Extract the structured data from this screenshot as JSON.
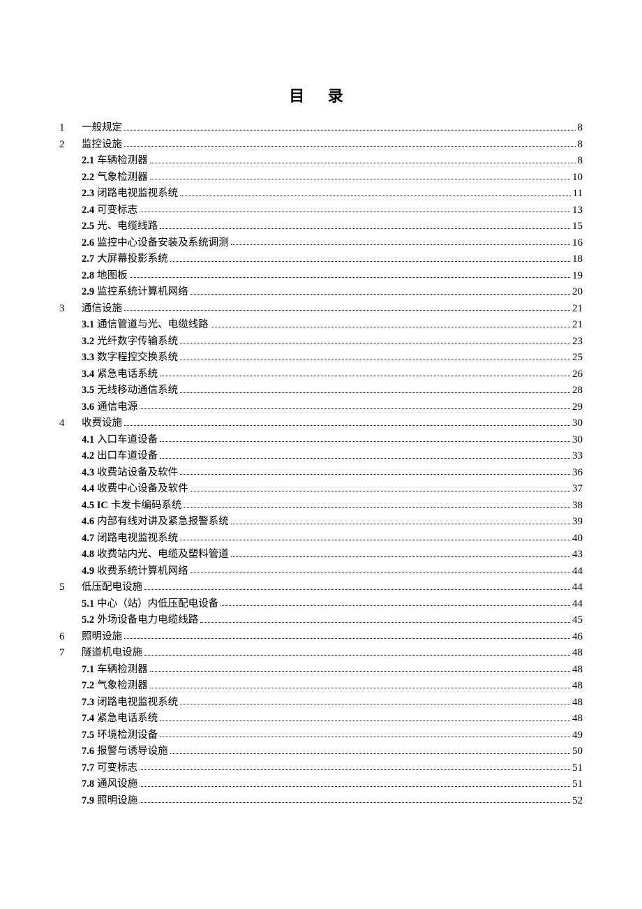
{
  "title": "目 录",
  "entries": [
    {
      "level": 1,
      "chapnum": "1",
      "secnum": "",
      "title": "一般规定",
      "page": "8"
    },
    {
      "level": 1,
      "chapnum": "2",
      "secnum": "",
      "title": "监控设施",
      "page": "8"
    },
    {
      "level": 2,
      "chapnum": "",
      "secnum": "2.1",
      "title": "车辆检测器",
      "page": "8"
    },
    {
      "level": 2,
      "chapnum": "",
      "secnum": "2.2",
      "title": "气象检测器",
      "page": "10"
    },
    {
      "level": 2,
      "chapnum": "",
      "secnum": "2.3",
      "title": "闭路电视监视系统",
      "page": "11"
    },
    {
      "level": 2,
      "chapnum": "",
      "secnum": "2.4",
      "title": "可变标志",
      "page": "13"
    },
    {
      "level": 2,
      "chapnum": "",
      "secnum": "2.5",
      "title": "光、电缆线路",
      "page": "15"
    },
    {
      "level": 2,
      "chapnum": "",
      "secnum": "2.6",
      "title": "监控中心设备安装及系统调测",
      "page": "16"
    },
    {
      "level": 2,
      "chapnum": "",
      "secnum": "2.7",
      "title": "大屏幕投影系统",
      "page": "18"
    },
    {
      "level": 2,
      "chapnum": "",
      "secnum": "2.8",
      "title": "地图板",
      "page": "19"
    },
    {
      "level": 2,
      "chapnum": "",
      "secnum": "2.9",
      "title": "监控系统计算机网络",
      "page": "20"
    },
    {
      "level": 1,
      "chapnum": "3",
      "secnum": "",
      "title": "通信设施",
      "page": "21"
    },
    {
      "level": 2,
      "chapnum": "",
      "secnum": "3.1",
      "title": "通信管道与光、电缆线路",
      "page": "21"
    },
    {
      "level": 2,
      "chapnum": "",
      "secnum": "3.2",
      "title": "光纤数字传输系统",
      "page": "23"
    },
    {
      "level": 2,
      "chapnum": "",
      "secnum": "3.3",
      "title": "数字程控交换系统",
      "page": "25"
    },
    {
      "level": 2,
      "chapnum": "",
      "secnum": "3.4",
      "title": "紧急电话系统",
      "page": "26"
    },
    {
      "level": 2,
      "chapnum": "",
      "secnum": "3.5",
      "title": "无线移动通信系统",
      "page": "28"
    },
    {
      "level": 2,
      "chapnum": "",
      "secnum": "3.6",
      "title": "通信电源",
      "page": "29"
    },
    {
      "level": 1,
      "chapnum": "4",
      "secnum": "",
      "title": "收费设施",
      "page": "30"
    },
    {
      "level": 2,
      "chapnum": "",
      "secnum": "4.1",
      "title": "入口车道设备",
      "page": "30"
    },
    {
      "level": 2,
      "chapnum": "",
      "secnum": "4.2",
      "title": "出口车道设备",
      "page": "33"
    },
    {
      "level": 2,
      "chapnum": "",
      "secnum": "4.3",
      "title": "收费站设备及软件",
      "page": "36"
    },
    {
      "level": 2,
      "chapnum": "",
      "secnum": "4.4",
      "title": "收费中心设备及软件",
      "page": "37"
    },
    {
      "level": 2,
      "chapnum": "",
      "secnum": "4.5 IC",
      "title": "卡发卡编码系统",
      "page": "38"
    },
    {
      "level": 2,
      "chapnum": "",
      "secnum": "4.6",
      "title": "内部有线对讲及紧急报警系统",
      "page": "39"
    },
    {
      "level": 2,
      "chapnum": "",
      "secnum": "4.7",
      "title": "闭路电视监视系统",
      "page": "40"
    },
    {
      "level": 2,
      "chapnum": "",
      "secnum": "4.8",
      "title": "收费站内光、电缆及塑料管道",
      "page": "43"
    },
    {
      "level": 2,
      "chapnum": "",
      "secnum": "4.9",
      "title": "收费系统计算机网络",
      "page": "44"
    },
    {
      "level": 1,
      "chapnum": "5",
      "secnum": "",
      "title": "低压配电设施",
      "page": "44"
    },
    {
      "level": 2,
      "chapnum": "",
      "secnum": "5.1",
      "title": "中心（站）内低压配电设备",
      "page": "44"
    },
    {
      "level": 2,
      "chapnum": "",
      "secnum": "5.2",
      "title": "外场设备电力电缆线路",
      "page": "45"
    },
    {
      "level": 1,
      "chapnum": "6",
      "secnum": "",
      "title": "照明设施",
      "page": "46"
    },
    {
      "level": 1,
      "chapnum": "7",
      "secnum": "",
      "title": "隧道机电设施",
      "page": "48"
    },
    {
      "level": 2,
      "chapnum": "",
      "secnum": "7.1",
      "title": "车辆检测器",
      "page": "48"
    },
    {
      "level": 2,
      "chapnum": "",
      "secnum": "7.2",
      "title": "气象检测器",
      "page": "48"
    },
    {
      "level": 2,
      "chapnum": "",
      "secnum": "7.3",
      "title": "闭路电视监视系统",
      "page": "48"
    },
    {
      "level": 2,
      "chapnum": "",
      "secnum": "7.4",
      "title": "紧急电话系统",
      "page": "48"
    },
    {
      "level": 2,
      "chapnum": "",
      "secnum": "7.5",
      "title": "环境检测设备",
      "page": "49"
    },
    {
      "level": 2,
      "chapnum": "",
      "secnum": "7.6",
      "title": "报警与诱导设施",
      "page": "50"
    },
    {
      "level": 2,
      "chapnum": "",
      "secnum": "7.7",
      "title": "可变标志",
      "page": "51"
    },
    {
      "level": 2,
      "chapnum": "",
      "secnum": "7.8",
      "title": "通风设施",
      "page": "51"
    },
    {
      "level": 2,
      "chapnum": "",
      "secnum": "7.9",
      "title": "照明设施",
      "page": "52"
    }
  ]
}
